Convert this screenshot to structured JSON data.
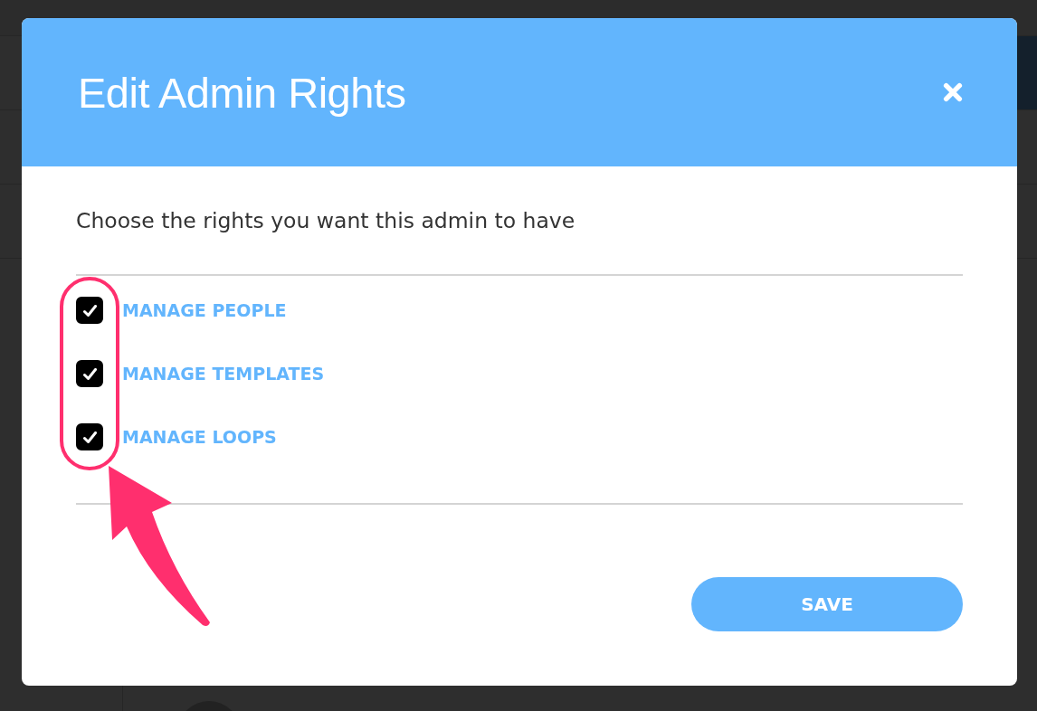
{
  "dialog": {
    "title": "Edit Admin Rights",
    "prompt": "Choose the rights you want this admin to have",
    "rights": [
      {
        "label": "MANAGE PEOPLE",
        "checked": true
      },
      {
        "label": "MANAGE TEMPLATES",
        "checked": true
      },
      {
        "label": "MANAGE LOOPS",
        "checked": true
      }
    ],
    "save_button": "SAVE"
  }
}
